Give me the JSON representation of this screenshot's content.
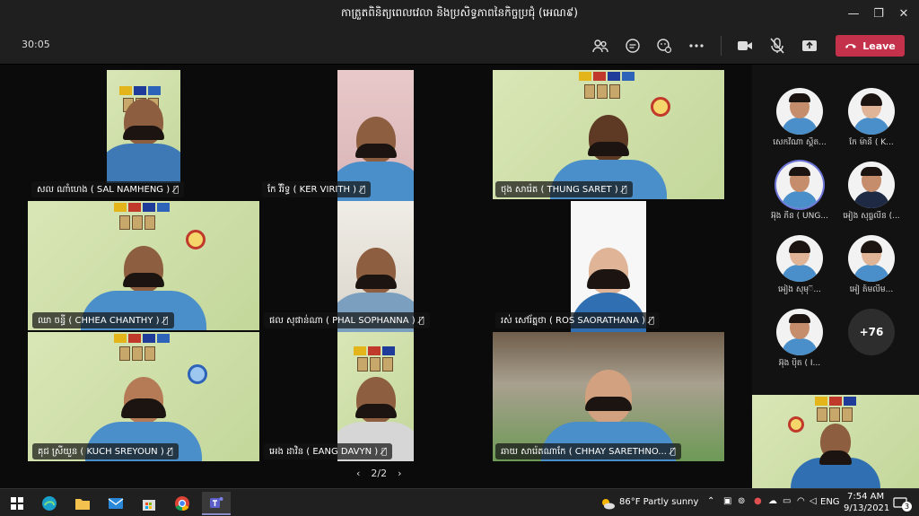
{
  "window": {
    "title": "កាត្រួតពិនិត្យពេលវេលា និងប្រសិទ្ធភាពនៃកិច្ចប្រជុំ (អេណ៩)",
    "minimize": "—",
    "restore": "❐",
    "close": "✕"
  },
  "toolbar": {
    "timer": "30:05",
    "icons": [
      "people-icon",
      "chat-icon",
      "reactions-icon",
      "more-icon",
      "camera-icon",
      "mic-off-icon",
      "share-icon"
    ],
    "leave_label": "Leave",
    "leave_color": "#c4314b"
  },
  "participants": [
    {
      "name": "សល ណាំហេង ( SAL NAMHENG )"
    },
    {
      "name": "កែ វីរិទ្ធ ( KER VIRITH )"
    },
    {
      "name": "ថុង សារ៉េត ( THUNG SARET )"
    },
    {
      "name": "ឈា ចន្ធី ( CHHEA CHANTHY )"
    },
    {
      "name": "ផល សុផាន់ណា ( PHAL SOPHANNA )"
    },
    {
      "name": "រស់ សៅរ័ត្នថា ( ROS SAORATHANA )"
    },
    {
      "name": "គុជ ស្រីយួន ( KUCH SREYOUN )"
    },
    {
      "name": "អេង ដាវិន ( EANG DAVYN )"
    },
    {
      "name": "ឆាយ សារ៉េតណាកែ ( CHHAY SARETHNO..."
    }
  ],
  "pager": {
    "prev": "‹",
    "page": "2/2",
    "next": "›"
  },
  "attendees": [
    {
      "name": "សេកវីណា ស្តិត..."
    },
    {
      "name": "កែ ម៉ានី ( K..."
    },
    {
      "name": "អ៊ុង ភីន ( UNG..."
    },
    {
      "name": "អៀង សុធ្លលីន (..."
    },
    {
      "name": "អៀង សុមុ៊..."
    },
    {
      "name": "អៀ ត៍មលីម..."
    },
    {
      "name": "អ៊ុង ប៉ិត ( I..."
    }
  ],
  "more_attendees": "+76",
  "taskbar": {
    "weather": "86°F  Partly sunny",
    "lang": "ENG",
    "time": "7:54 AM",
    "date": "9/13/2021",
    "notifications": "3"
  }
}
